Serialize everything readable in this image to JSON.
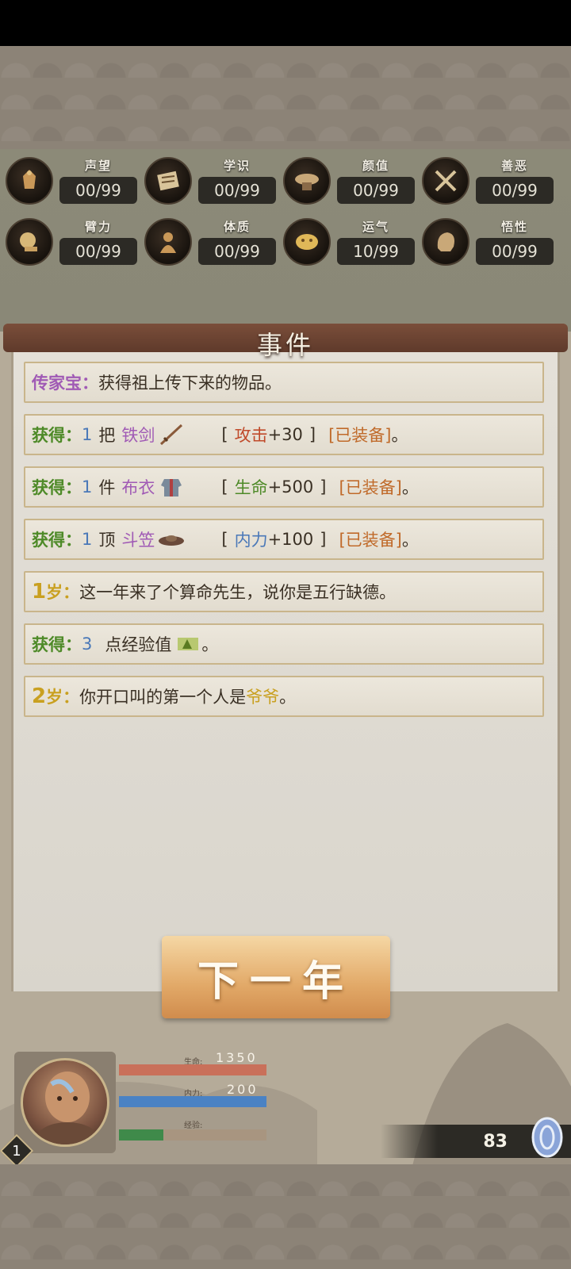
{
  "stats": [
    {
      "name": "声望",
      "value": "00/99",
      "icon": "prestige-icon"
    },
    {
      "name": "学识",
      "value": "00/99",
      "icon": "knowledge-icon"
    },
    {
      "name": "颜值",
      "value": "00/99",
      "icon": "appearance-icon"
    },
    {
      "name": "善恶",
      "value": "00/99",
      "icon": "morality-icon"
    },
    {
      "name": "臂力",
      "value": "00/99",
      "icon": "strength-icon"
    },
    {
      "name": "体质",
      "value": "00/99",
      "icon": "constitution-icon"
    },
    {
      "name": "运气",
      "value": "10/99",
      "icon": "luck-icon"
    },
    {
      "name": "悟性",
      "value": "00/99",
      "icon": "comprehension-icon"
    }
  ],
  "events_title": "事件",
  "events": {
    "e1": {
      "label": "传家宝：",
      "text": "获得祖上传下来的物品。"
    },
    "e2": {
      "label": "获得：",
      "qty": "1",
      "unit": "把",
      "item": "铁剑",
      "open": "[",
      "stat": "攻击",
      "bonus": "+30",
      "close": "]",
      "status": "[已装备]",
      "end": "。"
    },
    "e3": {
      "label": "获得：",
      "qty": "1",
      "unit": "件",
      "item": "布衣",
      "open": "[",
      "stat": "生命",
      "bonus": "+500",
      "close": "]",
      "status": "[已装备]",
      "end": "。"
    },
    "e4": {
      "label": "获得：",
      "qty": "1",
      "unit": "顶",
      "item": "斗笠",
      "open": "[",
      "stat": "内力",
      "bonus": "+100",
      "close": "]",
      "status": "[已装备]",
      "end": "。"
    },
    "e5": {
      "age": "1",
      "age_unit": "岁：",
      "text": "这一年来了个算命先生，说你是五行缺德。"
    },
    "e6": {
      "label": "获得：",
      "qty": "3",
      "text": "点经验值",
      "end": "。"
    },
    "e7": {
      "age": "2",
      "age_unit": "岁：",
      "text": "你开口叫的第一个人是",
      "highlight": "爷爷",
      "end": "。"
    }
  },
  "next_button": "下一年",
  "player": {
    "level": "1",
    "hp_label": "生命:",
    "hp_value": "1350",
    "hp_fraction": 1.0,
    "mp_label": "内力:",
    "mp_value": "200",
    "mp_fraction": 1.0,
    "exp_label": "经验:",
    "exp_fraction": 0.3
  },
  "currency": {
    "amount": "83",
    "icon": "coin-icon"
  },
  "colors": {
    "hp_bar": "#c9705a",
    "mp_bar": "#4a82c4",
    "exp_bar": "#3f8a4a",
    "scroll_header": "#6a4231",
    "button": "#e2a968"
  }
}
